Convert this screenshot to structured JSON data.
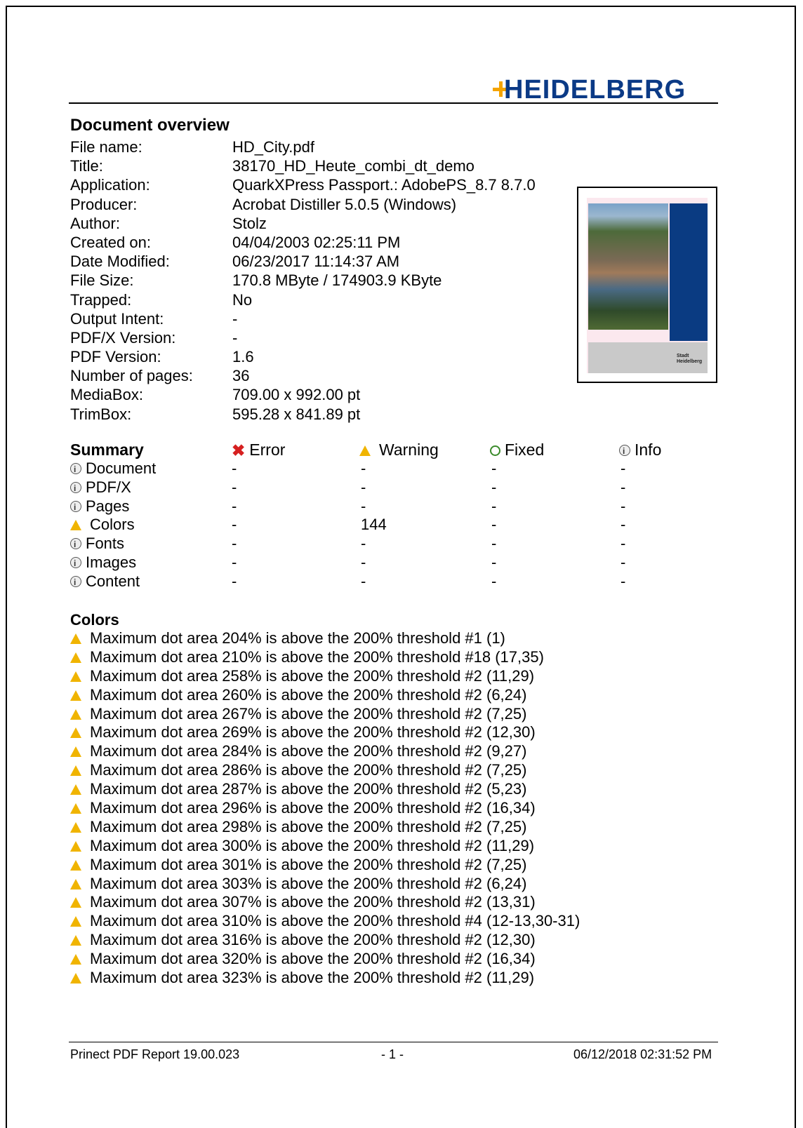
{
  "logo": {
    "text": "HEIDELBERG"
  },
  "overview": {
    "title": "Document overview",
    "rows": [
      {
        "key": "File name:",
        "value": "HD_City.pdf"
      },
      {
        "key": "Title:",
        "value": "38170_HD_Heute_combi_dt_demo"
      },
      {
        "key": "Application:",
        "value": "QuarkXPress Passport.: AdobePS_8.7 8.7.0"
      },
      {
        "key": "Producer:",
        "value": "Acrobat Distiller 5.0.5 (Windows)"
      },
      {
        "key": "Author:",
        "value": "Stolz"
      },
      {
        "key": "Created on:",
        "value": "04/04/2003 02:25:11 PM"
      },
      {
        "key": "Date Modified:",
        "value": "06/23/2017 11:14:37 AM"
      },
      {
        "key": "File Size:",
        "value": "170.8 MByte / 174903.9 KByte"
      },
      {
        "key": "Trapped:",
        "value": "No"
      },
      {
        "key": "Output Intent:",
        "value": "-"
      },
      {
        "key": "PDF/X Version:",
        "value": "-"
      },
      {
        "key": "PDF Version:",
        "value": "1.6"
      },
      {
        "key": "Number of pages:",
        "value": "36"
      },
      {
        "key": "MediaBox:",
        "value": "709.00 x 992.00 pt"
      },
      {
        "key": "TrimBox:",
        "value": "595.28 x 841.89 pt"
      }
    ]
  },
  "thumbnail": {
    "logo_text": "Stadt Heidelberg"
  },
  "summary": {
    "title": "Summary",
    "headers": {
      "error": "Error",
      "warning": "Warning",
      "fixed": "Fixed",
      "info": "Info"
    },
    "rows": [
      {
        "icon": "info-icon",
        "label": "Document",
        "error": "-",
        "warning": "-",
        "fixed": "-",
        "info": "-"
      },
      {
        "icon": "info-icon",
        "label": "PDF/X",
        "error": "-",
        "warning": "-",
        "fixed": "-",
        "info": "-"
      },
      {
        "icon": "info-icon",
        "label": "Pages",
        "error": "-",
        "warning": "-",
        "fixed": "-",
        "info": "-"
      },
      {
        "icon": "warning-icon",
        "label": "Colors",
        "error": "-",
        "warning": "144",
        "fixed": "-",
        "info": "-"
      },
      {
        "icon": "info-icon",
        "label": "Fonts",
        "error": "-",
        "warning": "-",
        "fixed": "-",
        "info": "-"
      },
      {
        "icon": "info-icon",
        "label": "Images",
        "error": "-",
        "warning": "-",
        "fixed": "-",
        "info": "-"
      },
      {
        "icon": "info-icon",
        "label": "Content",
        "error": "-",
        "warning": "-",
        "fixed": "-",
        "info": "-"
      }
    ]
  },
  "colors": {
    "title": "Colors",
    "items": [
      "Maximum dot area 204% is above the 200% threshold #1 (1)",
      "Maximum dot area 210% is above the 200% threshold #18 (17,35)",
      "Maximum dot area 258% is above the 200% threshold #2 (11,29)",
      "Maximum dot area 260% is above the 200% threshold #2 (6,24)",
      "Maximum dot area 267% is above the 200% threshold #2 (7,25)",
      "Maximum dot area 269% is above the 200% threshold #2 (12,30)",
      "Maximum dot area 284% is above the 200% threshold #2 (9,27)",
      "Maximum dot area 286% is above the 200% threshold #2 (7,25)",
      "Maximum dot area 287% is above the 200% threshold #2 (5,23)",
      "Maximum dot area 296% is above the 200% threshold #2 (16,34)",
      "Maximum dot area 298% is above the 200% threshold #2 (7,25)",
      "Maximum dot area 300% is above the 200% threshold #2 (11,29)",
      "Maximum dot area 301% is above the 200% threshold #2 (7,25)",
      "Maximum dot area 303% is above the 200% threshold #2 (6,24)",
      "Maximum dot area 307% is above the 200% threshold #2 (13,31)",
      "Maximum dot area 310% is above the 200% threshold #4 (12-13,30-31)",
      "Maximum dot area 316% is above the 200% threshold #2 (12,30)",
      "Maximum dot area 320% is above the 200% threshold #2 (16,34)",
      "Maximum dot area 323% is above the 200% threshold #2 (11,29)"
    ]
  },
  "footer": {
    "left": "Prinect PDF Report 19.00.023",
    "center": "- 1 -",
    "right": "06/12/2018 02:31:52 PM"
  },
  "colors_palette": {
    "brand_blue": "#0b3a86",
    "brand_orange": "#f4a400",
    "warning": "#f0b400",
    "error": "#d62020",
    "fixed": "#3a8a2a"
  }
}
